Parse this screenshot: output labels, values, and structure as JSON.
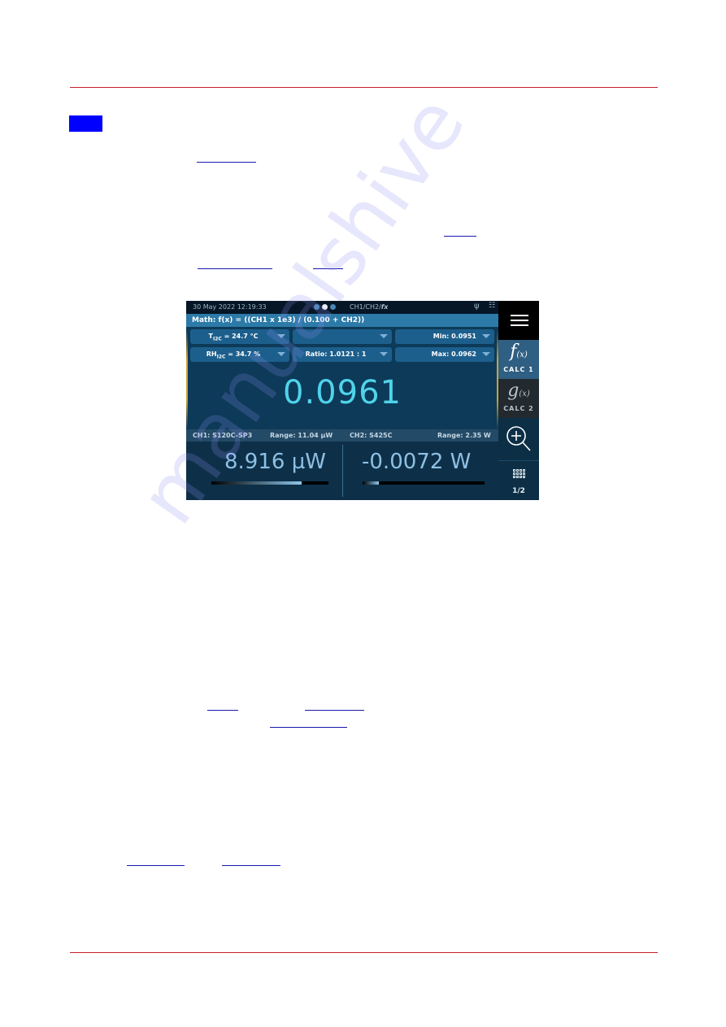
{
  "document": {
    "accent_rule_color": "#c8202a",
    "section_marker_color": "#0000ff",
    "link_color": "#1a1ab0",
    "watermark": "manualshive"
  },
  "device_screen": {
    "status_bar": {
      "datetime": "30 May 2022 12:19:33",
      "page_dots": [
        {
          "active": false
        },
        {
          "active": true
        },
        {
          "active": false
        }
      ],
      "mode": "CH1/CH2/",
      "mode_fx": "fx",
      "usb_icon": "usb-icon",
      "network_icon": "network-icon"
    },
    "math_expression": "Math: f(x) = ((CH1 x 1e3) / (0.100 + CH2))",
    "chips": {
      "temperature_label": "T",
      "temperature_sub": "I2C",
      "temperature_value": " = 24.7 °C",
      "empty_chip": "",
      "min": "Min: 0.0951",
      "humidity_label": "RH",
      "humidity_sub": "I2C",
      "humidity_value": " = 34.7 %",
      "ratio": "Ratio: 1.0121 : 1",
      "max": "Max: 0.0962"
    },
    "main_value": "0.0961",
    "channel_info": {
      "ch1_sensor": "CH1: S120C-SP3",
      "ch1_range": "Range: 11.04 µW",
      "ch2_sensor": "CH2: S425C",
      "ch2_range": "Range: 2.35 W"
    },
    "channels": [
      {
        "value": "8.916 µW",
        "range_fraction": 0.77
      },
      {
        "value": "-0.0072 W",
        "range_fraction": 0.13
      }
    ],
    "sidebar": {
      "menu_icon": "hamburger-menu-icon",
      "calc1_symbol": "f",
      "calc1_arg": "(x)",
      "calc1_label": "CALC 1",
      "calc2_symbol": "g",
      "calc2_arg": "(x)",
      "calc2_label": "CALC 2",
      "zoom_icon": "zoom-in-icon",
      "page_label": "1/2"
    }
  }
}
